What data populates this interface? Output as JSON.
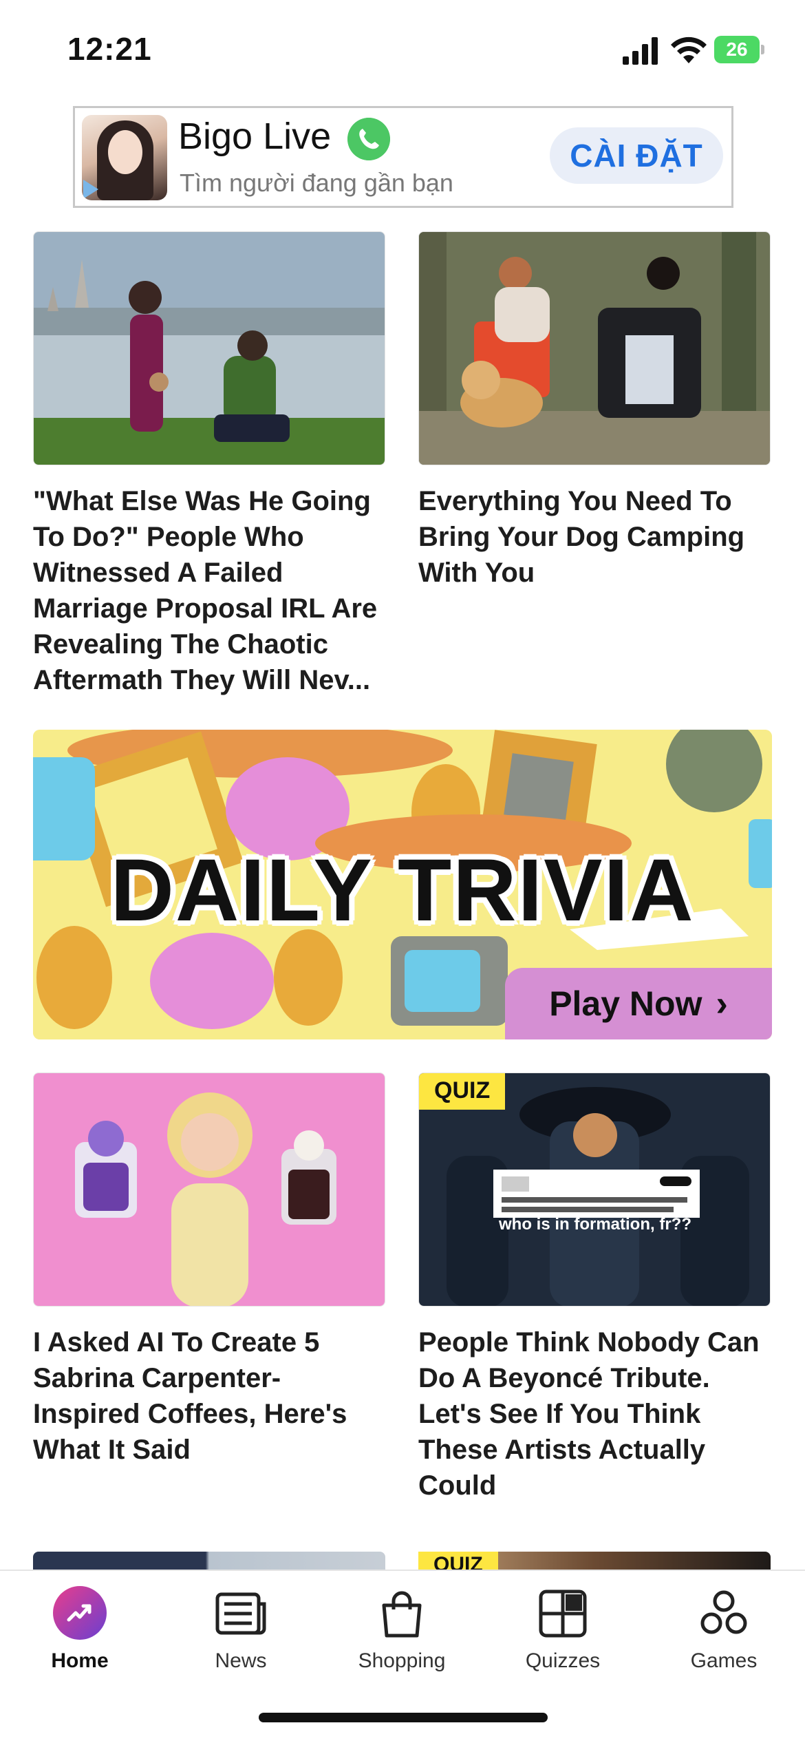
{
  "status_bar": {
    "time": "12:21",
    "battery": "26"
  },
  "ad": {
    "title": "Bigo Live",
    "subtitle": "Tìm người đang gần bạn",
    "install_label": "CÀI ĐẶT"
  },
  "cards": [
    {
      "title": "\"What Else Was He Going To Do?\" People Who Witnessed A Failed Marriage Proposal IRL Are Revealing The Chaotic Aftermath They Will Nev..."
    },
    {
      "title": "Everything You Need To Bring Your Dog Camping With You"
    },
    {
      "title": "I Asked AI To Create 5 Sabrina Carpenter-Inspired Coffees, Here's What It Said"
    },
    {
      "title": "People Think Nobody Can Do A Beyoncé Tribute. Let's See If You Think These Artists Actually Could",
      "badge": "QUIZ",
      "overlay": "who is in formation, fr??"
    }
  ],
  "trivia": {
    "title": "DAILY TRIVIA",
    "cta": "Play Now"
  },
  "peek": {
    "badge": "QUIZ"
  },
  "tabs": [
    {
      "label": "Home",
      "icon": "trending-icon",
      "active": true
    },
    {
      "label": "News",
      "icon": "newspaper-icon"
    },
    {
      "label": "Shopping",
      "icon": "shopping-bag-icon"
    },
    {
      "label": "Quizzes",
      "icon": "quiz-grid-icon"
    },
    {
      "label": "Games",
      "icon": "games-icon"
    }
  ],
  "colors": {
    "accent_pink": "#e83e8c",
    "accent_purple": "#6a3fd0",
    "quiz_yellow": "#fde641",
    "trivia_bg": "#f7ec8a",
    "cta_purple": "#d58fd3",
    "ad_blue": "#1f6fe0"
  }
}
